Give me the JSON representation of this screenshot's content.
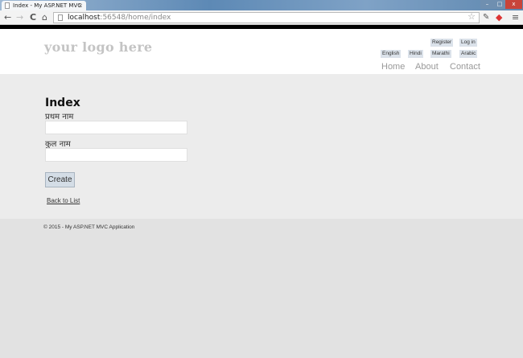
{
  "browser": {
    "tab_title": "Index - My ASP.NET MVC",
    "tab_close": "×",
    "url_host": "localhost",
    "url_rest": ":56548/home/index",
    "back": "←",
    "forward": "→",
    "reload": "C",
    "home": "⌂",
    "star": "☆",
    "menu": "≡",
    "minimize": "–",
    "maximize": "□",
    "close": "x"
  },
  "header": {
    "logo": "your logo here",
    "register": "Register",
    "login": "Log in",
    "languages": [
      "English",
      "Hindi",
      "Marathi",
      "Arabic"
    ],
    "menu": [
      "Home",
      "About",
      "Contact"
    ]
  },
  "main": {
    "title": "Index",
    "first_name_label": "प्रथम नाम",
    "first_name_value": "",
    "last_name_label": "कुल नाम",
    "last_name_value": "",
    "create": "Create",
    "back_link": "Back to List"
  },
  "footer": {
    "text": "© 2015 - My ASP.NET MVC Application"
  }
}
